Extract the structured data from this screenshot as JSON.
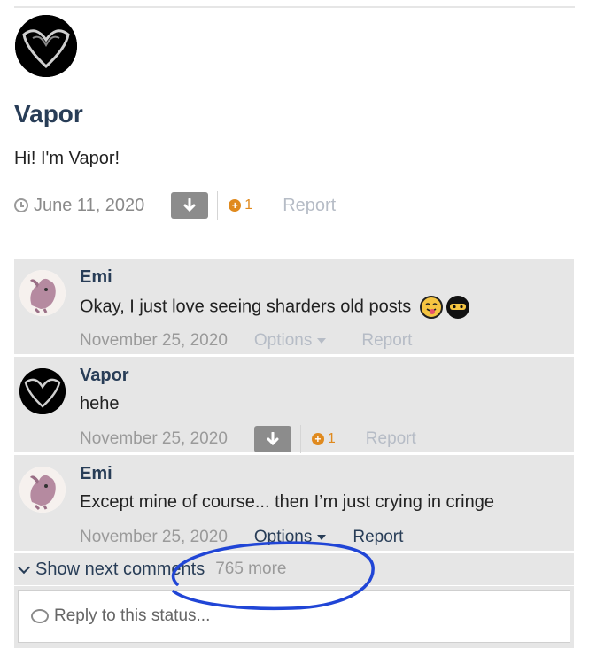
{
  "status": {
    "author": "Vapor",
    "text": "Hi! I'm Vapor!",
    "date": "June 11, 2020",
    "reputation": "1",
    "report_label": "Report"
  },
  "comments": [
    {
      "author": "Emi",
      "text": "Okay, I just love seeing sharders old posts",
      "date": "November 25, 2020",
      "options_label": "Options",
      "report_label": "Report"
    },
    {
      "author": "Vapor",
      "text": "hehe",
      "date": "November 25, 2020",
      "reputation": "1",
      "report_label": "Report"
    },
    {
      "author": "Emi",
      "text": "Except mine of course... then I’m just crying in cringe",
      "date": "November 25, 2020",
      "options_label": "Options",
      "report_label": "Report"
    }
  ],
  "next_comments": {
    "label": "Show next comments",
    "more": "765 more"
  },
  "reply": {
    "placeholder": "Reply to this status..."
  },
  "colors": {
    "name": "#283d57",
    "reputation": "#e08a1e",
    "annotation": "#2045d6"
  }
}
